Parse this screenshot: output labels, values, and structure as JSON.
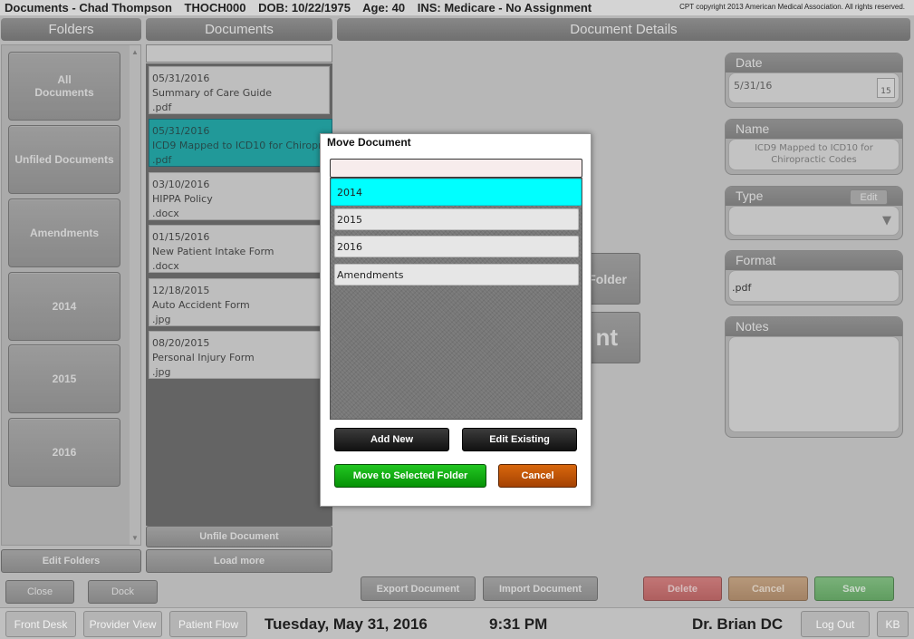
{
  "titlebar": {
    "title": "Documents - Chad Thompson",
    "patient_id": "THOCH000",
    "dob": "DOB: 10/22/1975",
    "age": "Age: 40",
    "insurance": "INS: Medicare - No Assignment",
    "copyright": "CPT copyright 2013 American Medical Association. All rights reserved."
  },
  "headers": {
    "folders": "Folders",
    "documents": "Documents",
    "details": "Document Details"
  },
  "folders": [
    {
      "label": "All\nDocuments"
    },
    {
      "label": "Unfiled Documents"
    },
    {
      "label": "Amendments"
    },
    {
      "label": "2014"
    },
    {
      "label": "2015"
    },
    {
      "label": "2016"
    }
  ],
  "documents": [
    {
      "date": "05/31/2016",
      "name": "Summary of Care Guide",
      "ext": ".pdf"
    },
    {
      "date": "05/31/2016",
      "name": "ICD9 Mapped to ICD10 for Chiropractic Codes",
      "ext": ".pdf"
    },
    {
      "date": "03/10/2016",
      "name": "HIPPA Policy",
      "ext": ".docx"
    },
    {
      "date": "01/15/2016",
      "name": "New Patient Intake Form",
      "ext": ".docx"
    },
    {
      "date": "12/18/2015",
      "name": "Auto Accident Form",
      "ext": ".jpg"
    },
    {
      "date": "08/20/2015",
      "name": "Personal Injury Form",
      "ext": ".jpg"
    }
  ],
  "doc_buttons": {
    "unfile": "Unfile Document",
    "load_more": "Load more",
    "edit_folders": "Edit Folders",
    "close": "Close",
    "dock": "Dock"
  },
  "details": {
    "date_label": "Date",
    "date_value": "5/31/16",
    "calendar_day": "15",
    "name_label": "Name",
    "name_value": "ICD9 Mapped to ICD10 for Chiropractic Codes",
    "type_label": "Type",
    "type_edit": "Edit",
    "format_label": "Format",
    "format_value": ".pdf",
    "notes_label": "Notes"
  },
  "behind_buttons": {
    "folder_partial": "Folder",
    "nt_partial": "nt"
  },
  "action_buttons": {
    "export": "Export Document",
    "import": "Import Document",
    "delete": "Delete",
    "cancel": "Cancel",
    "save": "Save"
  },
  "bottombar": {
    "front_desk": "Front Desk",
    "provider_view": "Provider View",
    "patient_flow": "Patient Flow",
    "date": "Tuesday, May 31, 2016",
    "time": "9:31 PM",
    "doctor": "Dr. Brian DC",
    "log_out": "Log Out",
    "kb": "KB"
  },
  "modal": {
    "title": "Move Document",
    "search_value": "",
    "folders": [
      "2014",
      "2015",
      "2016",
      "Amendments"
    ],
    "selected_index": 0,
    "add_new": "Add New",
    "edit_existing": "Edit Existing",
    "move": "Move to Selected Folder",
    "cancel": "Cancel"
  },
  "colors": {
    "selected_document": "#0aa3a3",
    "selected_folder": "#00ffff",
    "move_button": "#069206",
    "cancel_button": "#a54203"
  }
}
